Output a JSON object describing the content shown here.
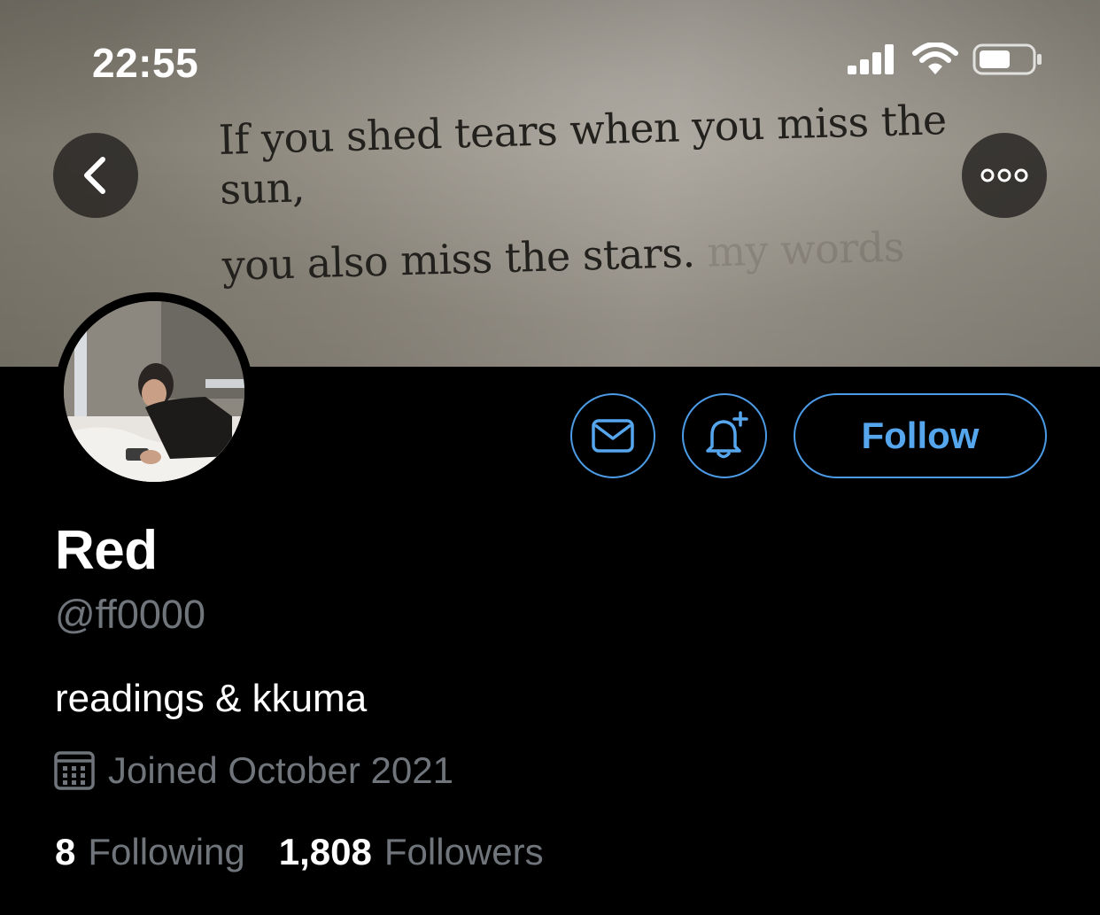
{
  "status_bar": {
    "time": "22:55"
  },
  "banner": {
    "quote_line1": "If you shed tears when you miss the sun,",
    "quote_line2": "you also miss the stars.",
    "faded_text": "my words"
  },
  "header": {
    "back_icon": "chevron-left-icon",
    "more_icon": "more-horizontal-icon"
  },
  "actions": {
    "message_icon": "envelope-icon",
    "notify_icon": "bell-plus-icon",
    "follow_label": "Follow"
  },
  "profile": {
    "name": "Red",
    "handle": "@ff0000",
    "bio": "readings & kkuma",
    "joined": "Joined October 2021",
    "following_count": "8",
    "following_label": "Following",
    "followers_count": "1,808",
    "followers_label": "Followers"
  },
  "colors": {
    "accent": "#4b9be6",
    "muted": "#6f757b",
    "background": "#000000"
  }
}
